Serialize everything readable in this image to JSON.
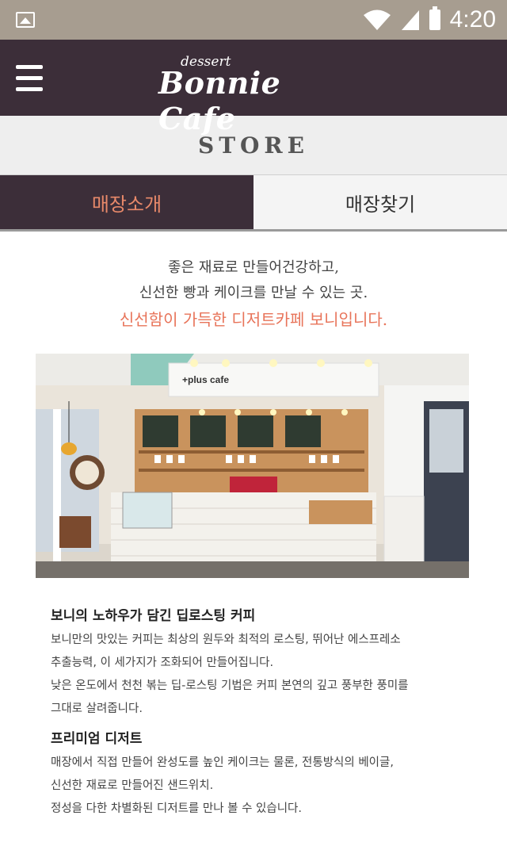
{
  "status_bar": {
    "time": "4:20",
    "icons": [
      "image-icon",
      "wifi-icon",
      "signal-icon",
      "battery-icon"
    ]
  },
  "header": {
    "brand_small": "dessert",
    "brand": "Bonnie Cafe",
    "menu_icon": "hamburger-menu-icon",
    "bg_color": "#3c2e39"
  },
  "page_title": "STORE",
  "tabs": [
    {
      "label": "매장소개",
      "active": true
    },
    {
      "label": "매장찾기",
      "active": false
    }
  ],
  "intro": {
    "line1": "좋은 재료로 만들어건강하고,",
    "line2": "신선한 빵과 케이크를 만날 수 있는 곳.",
    "highlight": "신선함이 가득한 디저트카페 보니입니다.",
    "accent_color": "#e8745a"
  },
  "photo": {
    "sign_text": "+plus cafe"
  },
  "sections": [
    {
      "title": "보니의 노하우가 담긴 딥로스팅 커피",
      "lines": [
        "보니만의 맛있는 커피는 최상의 원두와 최적의 로스팅, 뛰어난 에스프레소",
        "추출능력,  이 세가지가 조화되어 만들어집니다.",
        "낮은 온도에서 천천 볶는 딥-로스팅 기법은 커피 본연의 깊고 풍부한 풍미를",
        "그대로 살려줍니다."
      ]
    },
    {
      "title": "프리미엄 디저트",
      "lines": [
        "매장에서 직접 만들어 완성도를 높인 케이크는 물론, 전통방식의 베이글,",
        "신선한 재료로 만들어진 샌드위치.",
        "정성을 다한 차별화된 디저트를 만나 볼 수 있습니다."
      ]
    }
  ]
}
